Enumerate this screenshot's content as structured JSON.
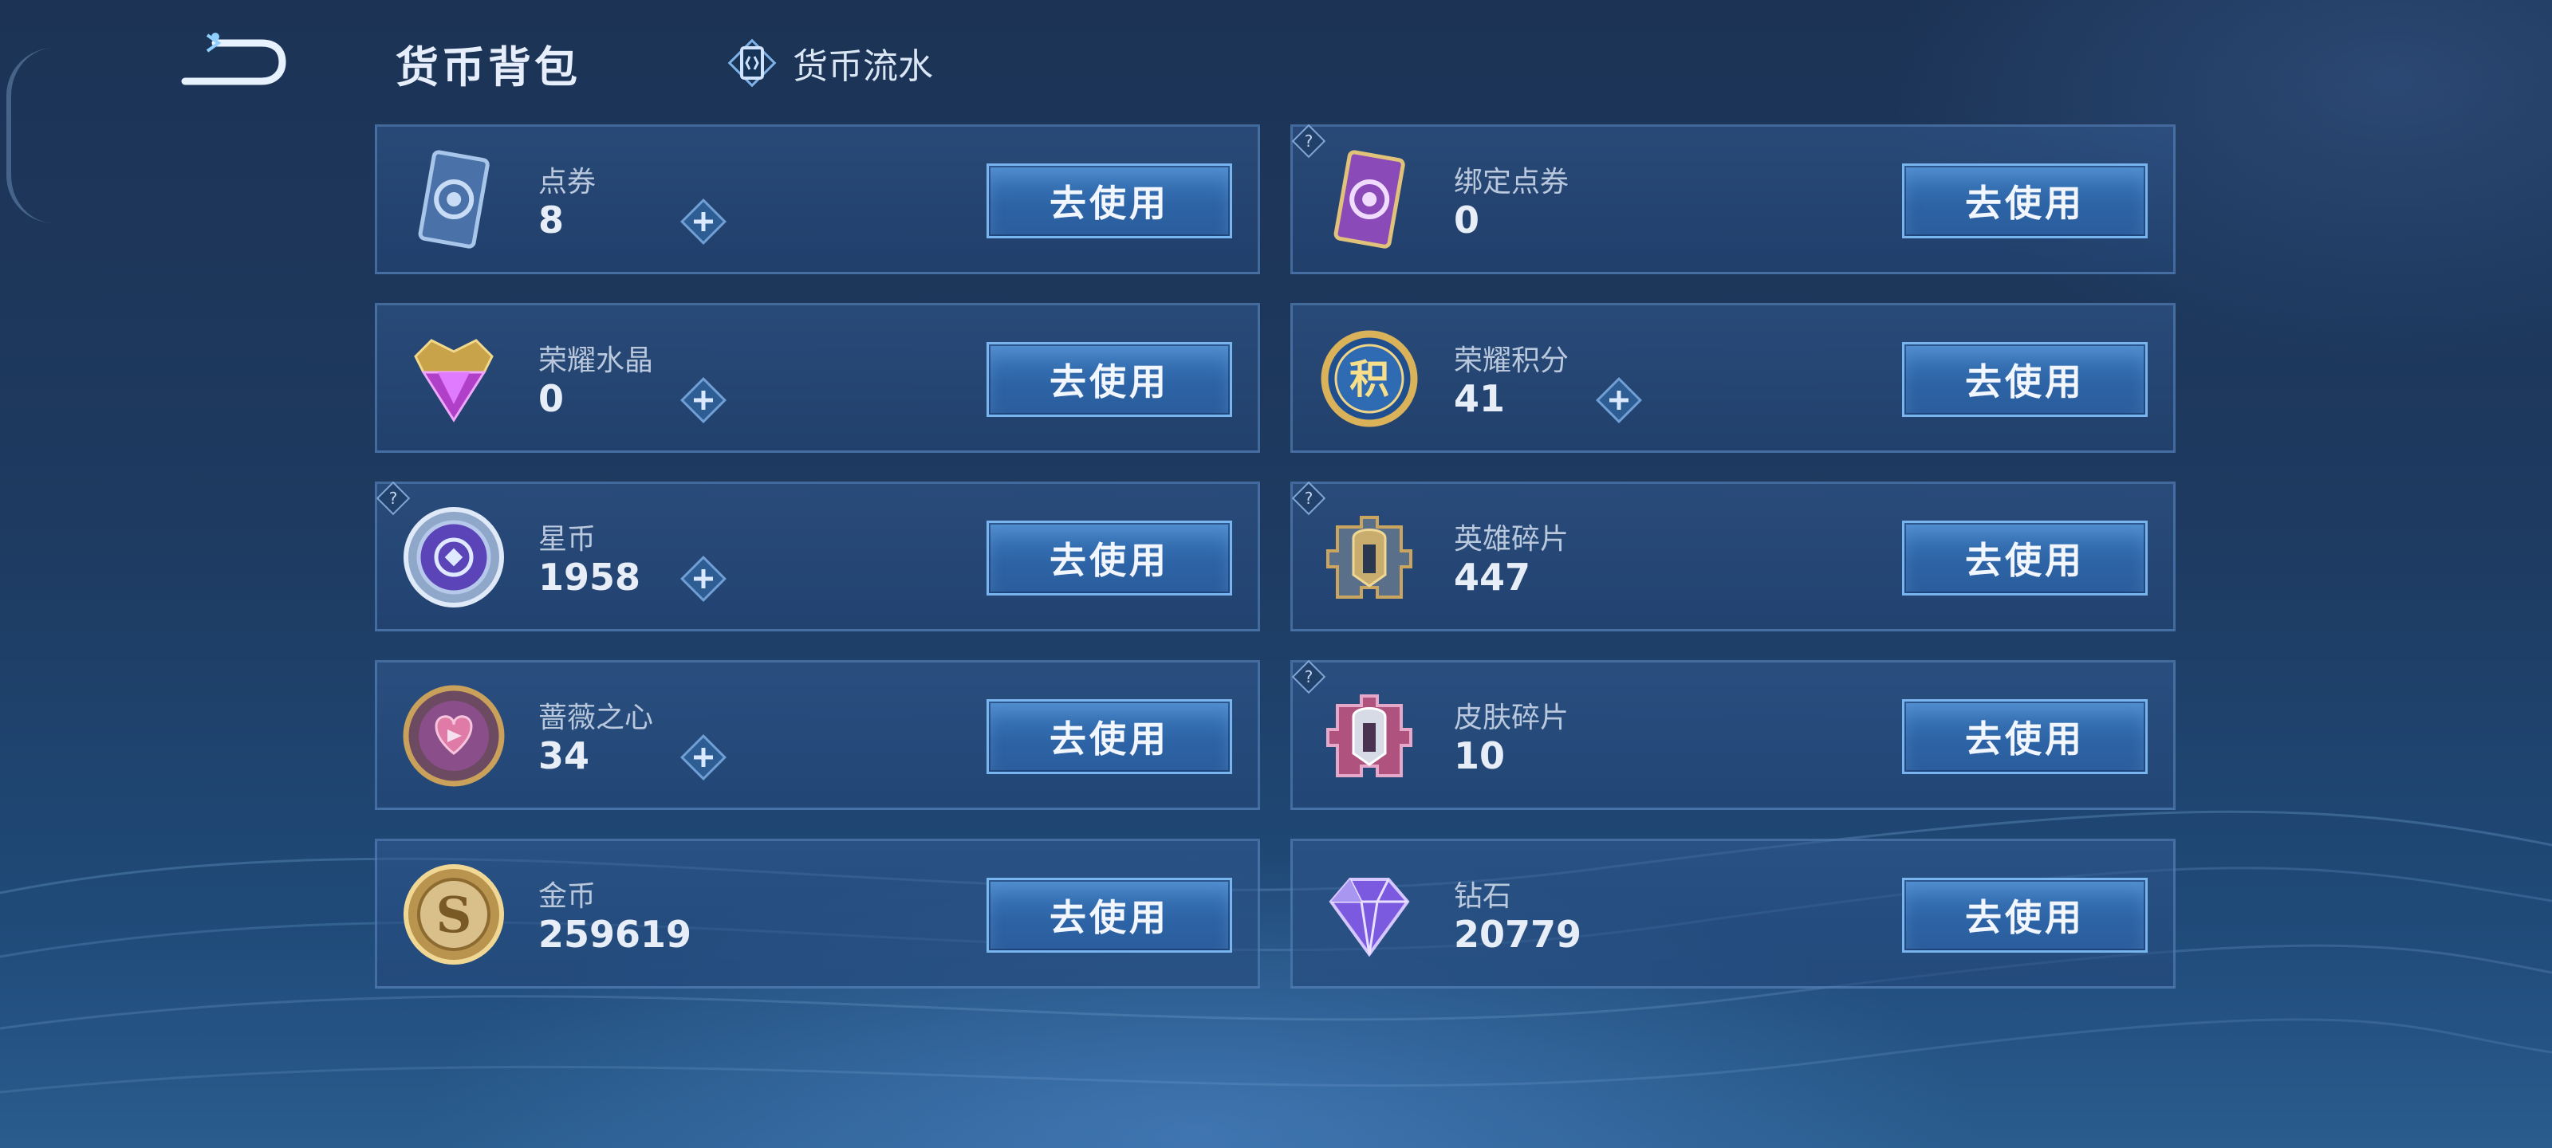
{
  "header": {
    "title": "货币背包",
    "ledger_label": "货币流水"
  },
  "cards": [
    {
      "name": "点券",
      "value": "8",
      "button": "去使用"
    },
    {
      "name": "绑定点券",
      "value": "0",
      "button": "去使用"
    },
    {
      "name": "荣耀水晶",
      "value": "0",
      "button": "去使用"
    },
    {
      "name": "荣耀积分",
      "value": "41",
      "button": "去使用"
    },
    {
      "name": "星币",
      "value": "1958",
      "button": "去使用"
    },
    {
      "name": "英雄碎片",
      "value": "447",
      "button": "去使用"
    },
    {
      "name": "蔷薇之心",
      "value": "34",
      "button": "去使用"
    },
    {
      "name": "皮肤碎片",
      "value": "10",
      "button": "去使用"
    },
    {
      "name": "金币",
      "value": "259619",
      "button": "去使用"
    },
    {
      "name": "钻石",
      "value": "20779",
      "button": "去使用"
    }
  ],
  "icons": {
    "coupon": "coupon-ticket-icon",
    "bound_coupon": "bound-coupon-ticket-icon",
    "crystal": "honor-crystal-icon",
    "points": "honor-points-icon",
    "star": "star-coin-icon",
    "hero_shard": "hero-shard-icon",
    "rose": "rose-heart-icon",
    "skin_shard": "skin-shard-icon",
    "gold": "gold-coin-icon",
    "diamond": "diamond-icon"
  },
  "icon_glyphs": {
    "points": "积",
    "gold": "S"
  },
  "colors": {
    "button_border": "#78b4ee",
    "card_border": "#5f8cc3",
    "accent": "#3f7fc2"
  }
}
